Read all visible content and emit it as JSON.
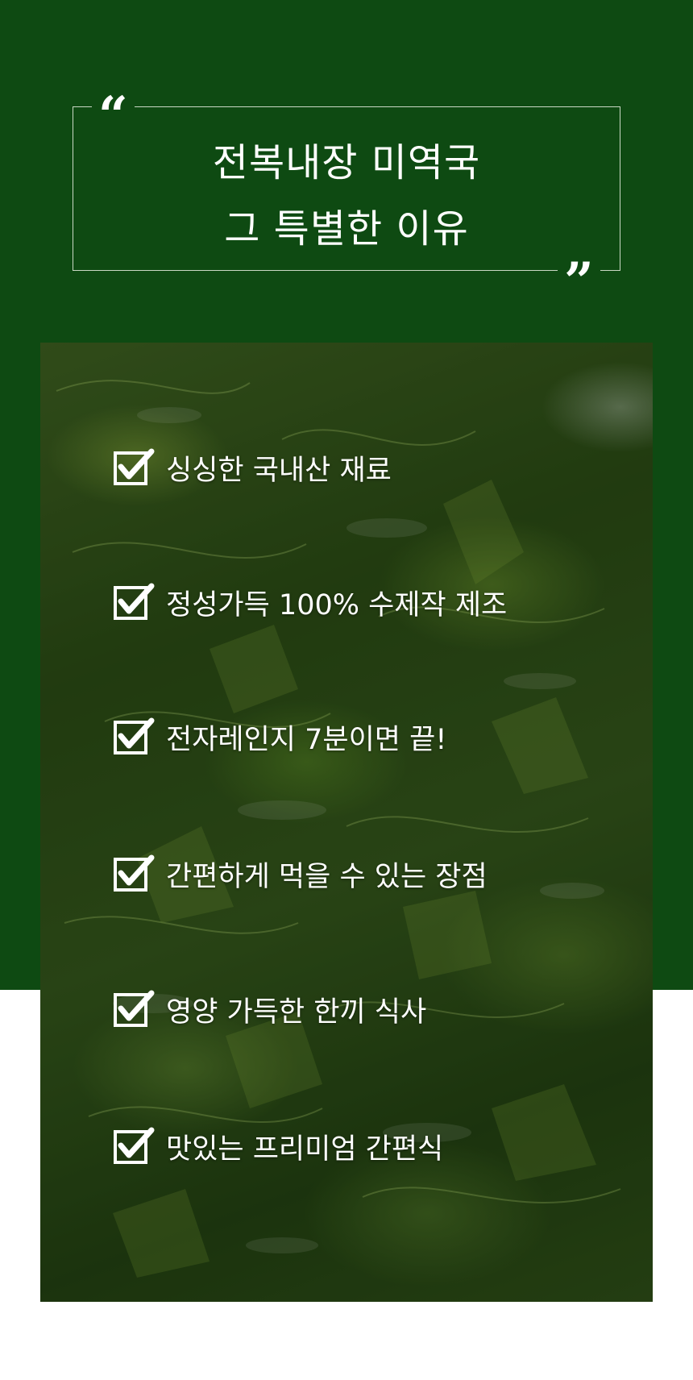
{
  "header": {
    "title_line_1": "전복내장 미역국",
    "title_line_2": "그 특별한 이유",
    "quote_open": "“",
    "quote_close": "”"
  },
  "image": {
    "subject": "seaweed-photo"
  },
  "features": [
    {
      "label": "싱싱한 국내산 재료",
      "icon": "checkbox-checked-icon"
    },
    {
      "label": "정성가득 100% 수제작 제조",
      "icon": "checkbox-checked-icon"
    },
    {
      "label": "전자레인지 7분이면 끝!",
      "icon": "checkbox-checked-icon"
    },
    {
      "label": "간편하게 먹을 수 있는 장점",
      "icon": "checkbox-checked-icon"
    },
    {
      "label": "영양 가득한 한끼 식사",
      "icon": "checkbox-checked-icon"
    },
    {
      "label": "맛있는 프리미엄 간편식",
      "icon": "checkbox-checked-icon"
    }
  ],
  "colors": {
    "background_green": "#0e4a12",
    "frame_line": "#c9d8c4",
    "text": "#ffffff"
  }
}
